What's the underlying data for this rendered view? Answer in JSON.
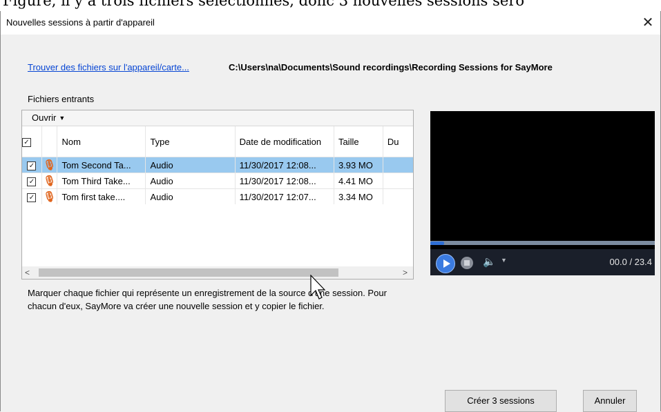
{
  "background_doc_text": "Figure, il y a trois fichiers sélectionnés, donc 3 nouvelles sessions sero",
  "window": {
    "title": "Nouvelles sessions à partir d'appareil",
    "close_glyph": "✕"
  },
  "source": {
    "link_label": "Trouver des fichiers sur l'appareil/carte...",
    "path": "C:\\Users\\na\\Documents\\Sound recordings\\Recording Sessions for SayMore"
  },
  "incoming": {
    "label": "Fichiers entrants",
    "toolbar_open": "Ouvrir",
    "columns": {
      "name": "Nom",
      "type": "Type",
      "date": "Date de modification",
      "size": "Taille",
      "duration": "Du"
    },
    "rows": [
      {
        "checked": true,
        "name": "Tom Second Ta...",
        "type": "Audio",
        "date": "11/30/2017 12:08...",
        "size": "3.93 MO",
        "selected": true
      },
      {
        "checked": true,
        "name": "Tom Third Take...",
        "type": "Audio",
        "date": "11/30/2017 12:08...",
        "size": "4.41 MO",
        "selected": false
      },
      {
        "checked": true,
        "name": "Tom first take....",
        "type": "Audio",
        "date": "11/30/2017 12:07...",
        "size": "3.34 MO",
        "selected": false
      }
    ]
  },
  "instructions": "Marquer chaque fichier qui représente un enregistrement de la source d'une session. Pour chacun d'eux, SayMore va créer une nouvelle session et y copier le fichier.",
  "player": {
    "time": "00.0 / 23.4",
    "progress_fraction": 0.0
  },
  "buttons": {
    "create": "Créer 3 sessions",
    "cancel": "Annuler"
  },
  "colors": {
    "link": "#0645d4",
    "selection": "#99c9ef",
    "mic_icon": "#e0641c",
    "play_button": "#3b7be0"
  }
}
